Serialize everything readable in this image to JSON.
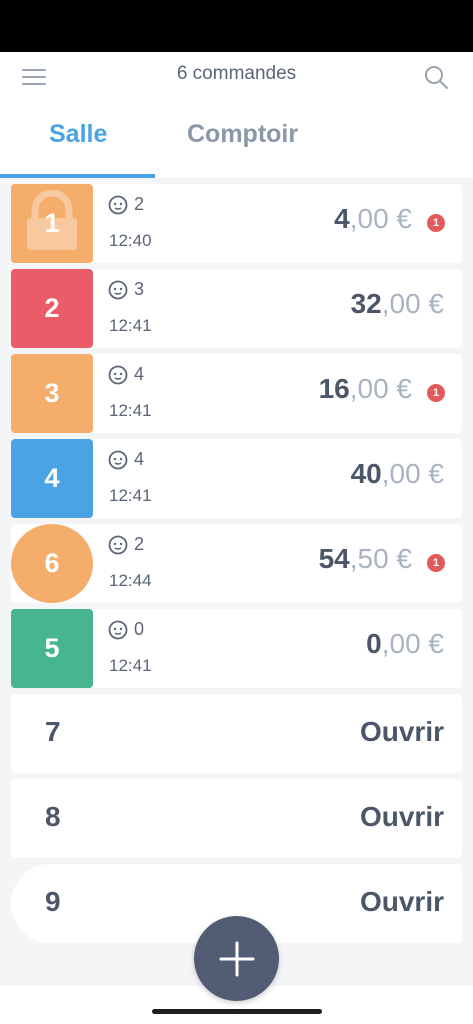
{
  "header": {
    "title": "6 commandes"
  },
  "tabs": [
    {
      "label": "Salle",
      "active": true
    },
    {
      "label": "Comptoir",
      "active": false
    }
  ],
  "orders": [
    {
      "table": "1",
      "color": "#f4ad6a",
      "shape": "square",
      "locked": true,
      "guests": "2",
      "time": "12:40",
      "amount_int": "4",
      "amount_dec": ",00 €",
      "alert": "1"
    },
    {
      "table": "2",
      "color": "#ea5d68",
      "shape": "square",
      "locked": false,
      "guests": "3",
      "time": "12:41",
      "amount_int": "32",
      "amount_dec": ",00 €",
      "alert": null
    },
    {
      "table": "3",
      "color": "#f4ad6a",
      "shape": "square",
      "locked": false,
      "guests": "4",
      "time": "12:41",
      "amount_int": "16",
      "amount_dec": ",00 €",
      "alert": "1"
    },
    {
      "table": "4",
      "color": "#4aa3e3",
      "shape": "square",
      "locked": false,
      "guests": "4",
      "time": "12:41",
      "amount_int": "40",
      "amount_dec": ",00 €",
      "alert": null
    },
    {
      "table": "6",
      "color": "#f4ad6a",
      "shape": "circle",
      "locked": false,
      "guests": "2",
      "time": "12:44",
      "amount_int": "54",
      "amount_dec": ",50 €",
      "alert": "1"
    },
    {
      "table": "5",
      "color": "#48b592",
      "shape": "square",
      "locked": false,
      "guests": "0",
      "time": "12:41",
      "amount_int": "0",
      "amount_dec": ",00 €",
      "alert": null
    }
  ],
  "empty_tables": [
    {
      "table": "7",
      "action": "Ouvrir"
    },
    {
      "table": "8",
      "action": "Ouvrir"
    },
    {
      "table": "9",
      "action": "Ouvrir"
    }
  ],
  "icons": {
    "menu": "hamburger-icon",
    "search": "search-icon",
    "guests": "guests-icon",
    "lock": "lock-icon",
    "add": "plus-icon"
  },
  "colors": {
    "accent": "#4aa3e3",
    "text": "#4c5669",
    "alert": "#e35a5a",
    "fab": "#525c72"
  }
}
